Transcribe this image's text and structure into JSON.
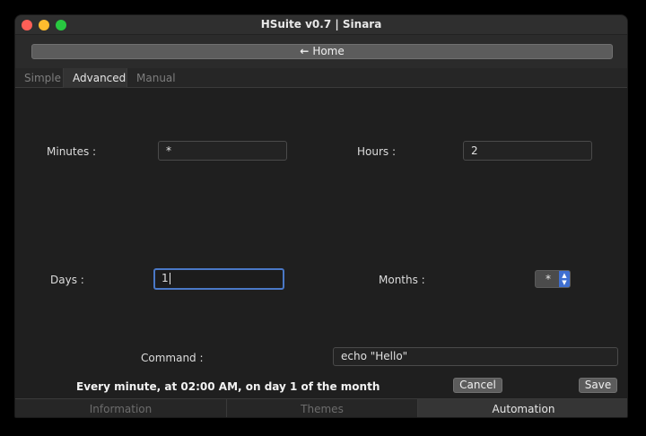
{
  "window": {
    "title": "HSuite v0.7 | Sinara"
  },
  "home_button": {
    "label": "Home",
    "icon": "arrow-left-icon"
  },
  "tabs": [
    {
      "label": "Simple",
      "active": false
    },
    {
      "label": "Advanced",
      "active": true
    },
    {
      "label": "Manual",
      "active": false
    }
  ],
  "form": {
    "minutes_label": "Minutes :",
    "minutes_value": "*",
    "hours_label": "Hours :",
    "hours_value": "2",
    "days_label": "Days :",
    "days_value": "1",
    "months_label": "Months :",
    "months_value": "*",
    "command_label": "Command :",
    "command_value": "echo \"Hello\""
  },
  "summary": "Every minute, at 02:00 AM, on day 1 of the month",
  "actions": {
    "cancel_label": "Cancel",
    "save_label": "Save"
  },
  "bottom_tabs": [
    {
      "label": "Information",
      "active": false
    },
    {
      "label": "Themes",
      "active": false
    },
    {
      "label": "Automation",
      "active": true
    }
  ],
  "colors": {
    "focus": "#4a78c6",
    "spinner_accent": "#3f6fd1",
    "close": "#ff5f57",
    "minimize": "#febc2e",
    "maximize": "#28c840"
  }
}
